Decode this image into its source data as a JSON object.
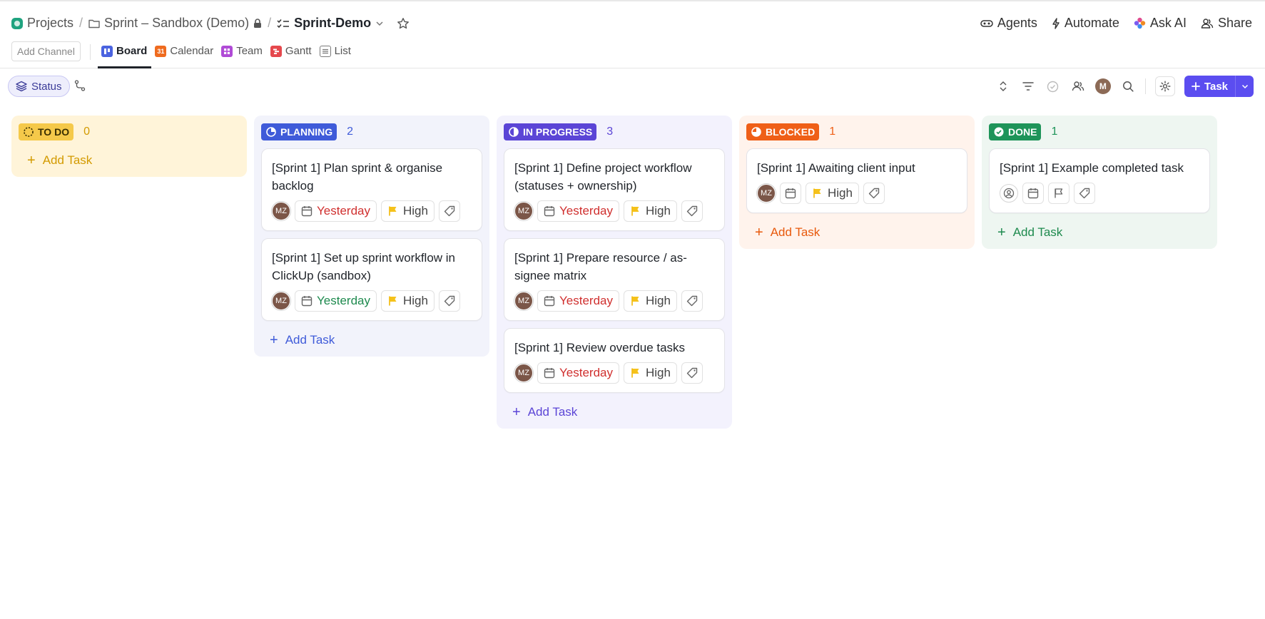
{
  "breadcrumb": {
    "space": "Projects",
    "folder": "Sprint – Sandbox (Demo)",
    "list": "Sprint-Demo"
  },
  "top_actions": {
    "agents": "Agents",
    "automate": "Automate",
    "ask_ai": "Ask AI",
    "share": "Share"
  },
  "views": {
    "add_channel": "Add Channel",
    "tabs": [
      {
        "label": "Board",
        "color": "#4a63e0",
        "glyph": ""
      },
      {
        "label": "Calendar",
        "color": "#ef6b1f",
        "glyph": "31"
      },
      {
        "label": "Team",
        "color": "#b04bd6",
        "glyph": ""
      },
      {
        "label": "Gantt",
        "color": "#e5484d",
        "glyph": ""
      },
      {
        "label": "List",
        "color": "#7a7a7a",
        "glyph": ""
      }
    ]
  },
  "toolbar": {
    "group_by": "Status",
    "avatar_initial": "M",
    "task_button": "Task"
  },
  "columns": [
    {
      "status": "TO DO",
      "count": "0",
      "badge_color": "#f5c94a",
      "badge_text": "#3a2f00",
      "bg": "#fff4d9",
      "count_color": "#d39a00",
      "add_label": "Add Task",
      "add_color": "#d39a00",
      "cards": []
    },
    {
      "status": "PLANNING",
      "count": "2",
      "badge_color": "#3f5bd9",
      "badge_text": "#ffffff",
      "bg": "#f2f3fb",
      "count_color": "#3f5bd9",
      "add_label": "Add Task",
      "add_color": "#3f5bd9",
      "cards": [
        {
          "title": "[Sprint 1] Plan sprint & organise backlog",
          "assignee": "MZ",
          "date": "Yesterday",
          "date_color": "red",
          "priority": "High"
        },
        {
          "title": "[Sprint 1] Set up sprint workflow in ClickUp (sandbox)",
          "assignee": "MZ",
          "date": "Yesterday",
          "date_color": "green",
          "priority": "High"
        }
      ]
    },
    {
      "status": "IN PROGRESS",
      "count": "3",
      "badge_color": "#5b45d6",
      "badge_text": "#ffffff",
      "bg": "#f3f2fd",
      "count_color": "#5b45d6",
      "add_label": "Add Task",
      "add_color": "#5b45d6",
      "cards": [
        {
          "title": "[Sprint 1] Define project workflow (statuses + ownership)",
          "assignee": "MZ",
          "date": "Yesterday",
          "date_color": "red",
          "priority": "High"
        },
        {
          "title": "[Sprint 1] Prepare resource / as-signee matrix",
          "assignee": "MZ",
          "date": "Yesterday",
          "date_color": "red",
          "priority": "High"
        },
        {
          "title": "[Sprint 1] Review overdue tasks",
          "assignee": "MZ",
          "date": "Yesterday",
          "date_color": "red",
          "priority": "High"
        }
      ]
    },
    {
      "status": "BLOCKED",
      "count": "1",
      "badge_color": "#ef5f17",
      "badge_text": "#ffffff",
      "bg": "#fff3ec",
      "count_color": "#ef5f17",
      "add_label": "Add Task",
      "add_color": "#e8590c",
      "cards": [
        {
          "title": "[Sprint 1] Awaiting client input",
          "assignee": "MZ",
          "date": "",
          "date_color": "none",
          "priority": "High"
        }
      ]
    },
    {
      "status": "DONE",
      "count": "1",
      "badge_color": "#1e9459",
      "badge_text": "#ffffff",
      "bg": "#eef6f1",
      "count_color": "#1e9459",
      "add_label": "Add Task",
      "add_color": "#1e8a4e",
      "cards": [
        {
          "title": "[Sprint 1] Example completed task",
          "assignee": "",
          "date": "",
          "date_color": "none",
          "priority": ""
        }
      ]
    }
  ]
}
